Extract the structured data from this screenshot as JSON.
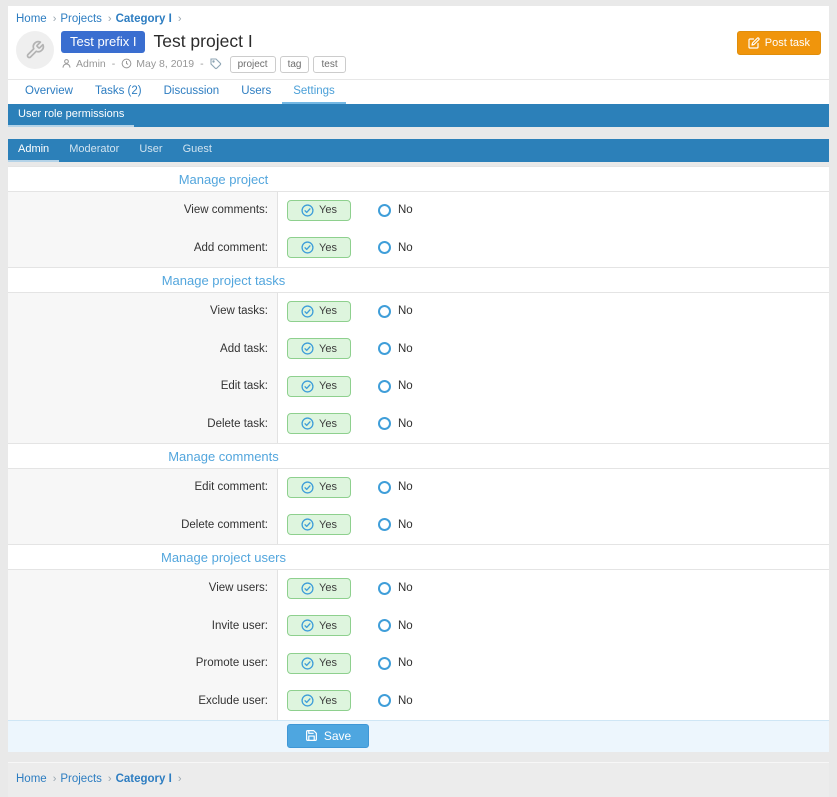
{
  "colors": {
    "page_bg": "#e9e9e9",
    "bar_blue": "#2c80b9",
    "link_blue": "#2d7dc1",
    "accent_blue": "#53a6dd",
    "control_blue": "#3f9ed9",
    "badge_blue": "#3a6ed0",
    "orange": "#f0950c",
    "yes_bg": "#def5de",
    "yes_border": "#8ed08e",
    "save_blue": "#4ea6e0",
    "save_row_bg": "#edf6fd",
    "label_col_bg": "#f7f7f7"
  },
  "breadcrumb": {
    "items": [
      {
        "label": "Home",
        "current": false
      },
      {
        "label": "Projects",
        "current": false
      },
      {
        "label": "Category I",
        "current": true
      }
    ],
    "chevron": "›"
  },
  "header": {
    "prefix_badge": "Test prefix I",
    "title": "Test project I",
    "author": "Admin",
    "date": "May 8, 2019",
    "separator": "-",
    "tags": [
      "project",
      "tag",
      "test"
    ],
    "post_task_label": "Post task"
  },
  "tabs": [
    {
      "label": "Overview",
      "active": false
    },
    {
      "label": "Tasks (2)",
      "active": false
    },
    {
      "label": "Discussion",
      "active": false
    },
    {
      "label": "Users",
      "active": false
    },
    {
      "label": "Settings",
      "active": true
    }
  ],
  "panel": {
    "title": "User role permissions"
  },
  "role_tabs": [
    {
      "label": "Admin",
      "active": true
    },
    {
      "label": "Moderator",
      "active": false
    },
    {
      "label": "User",
      "active": false
    },
    {
      "label": "Guest",
      "active": false
    }
  ],
  "permissions": {
    "yes_label": "Yes",
    "no_label": "No",
    "sections": [
      {
        "title": "Manage project",
        "rows": [
          {
            "label": "View comments:",
            "value": "yes"
          },
          {
            "label": "Add comment:",
            "value": "yes"
          }
        ]
      },
      {
        "title": "Manage project tasks",
        "rows": [
          {
            "label": "View tasks:",
            "value": "yes"
          },
          {
            "label": "Add task:",
            "value": "yes"
          },
          {
            "label": "Edit task:",
            "value": "yes"
          },
          {
            "label": "Delete task:",
            "value": "yes"
          }
        ]
      },
      {
        "title": "Manage comments",
        "rows": [
          {
            "label": "Edit comment:",
            "value": "yes"
          },
          {
            "label": "Delete comment:",
            "value": "yes"
          }
        ]
      },
      {
        "title": "Manage project users",
        "rows": [
          {
            "label": "View users:",
            "value": "yes"
          },
          {
            "label": "Invite user:",
            "value": "yes"
          },
          {
            "label": "Promote user:",
            "value": "yes"
          },
          {
            "label": "Exclude user:",
            "value": "yes"
          }
        ]
      }
    ]
  },
  "save_label": "Save"
}
